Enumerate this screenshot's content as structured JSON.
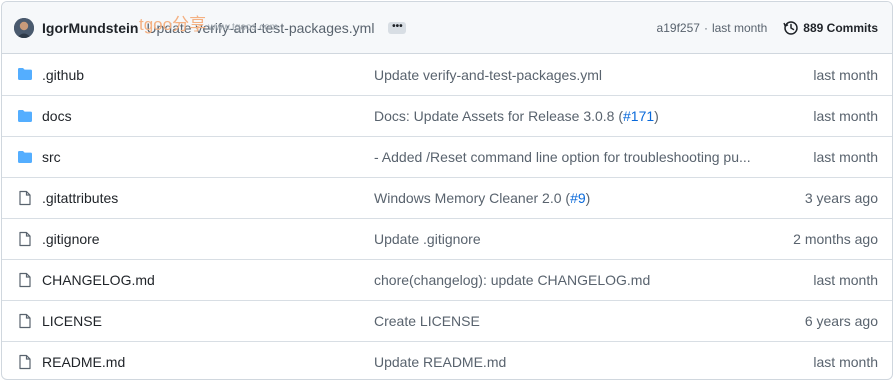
{
  "header": {
    "author": "IgorMundstein",
    "commit_message": "Update verify-and-test-packages.yml",
    "sha": "a19f257",
    "separator": "·",
    "time": "last month",
    "commits_label": "889 Commits"
  },
  "watermark": {
    "brand": "tgoo分享",
    "url": "www.tgoos.com"
  },
  "files": [
    {
      "type": "folder",
      "name": ".github",
      "message": "Update verify-and-test-packages.yml",
      "age": "last month"
    },
    {
      "type": "folder",
      "name": "docs",
      "message_prefix": "Docs: Update Assets for Release 3.0.8 (",
      "link": "#171",
      "message_suffix": ")",
      "age": "last month"
    },
    {
      "type": "folder",
      "name": "src",
      "message": "- Added /Reset command line option for troubleshooting pu...",
      "age": "last month"
    },
    {
      "type": "file",
      "name": ".gitattributes",
      "message_prefix": "Windows Memory Cleaner 2.0 (",
      "link": "#9",
      "message_suffix": ")",
      "age": "3 years ago"
    },
    {
      "type": "file",
      "name": ".gitignore",
      "message": "Update .gitignore",
      "age": "2 months ago"
    },
    {
      "type": "file",
      "name": "CHANGELOG.md",
      "message": "chore(changelog): update CHANGELOG.md",
      "age": "last month"
    },
    {
      "type": "file",
      "name": "LICENSE",
      "message": "Create LICENSE",
      "age": "6 years ago"
    },
    {
      "type": "file",
      "name": "README.md",
      "message": "Update README.md",
      "age": "last month"
    }
  ],
  "colors": {
    "folder": "#54aeff",
    "file": "#59636e",
    "link": "#0969da"
  }
}
